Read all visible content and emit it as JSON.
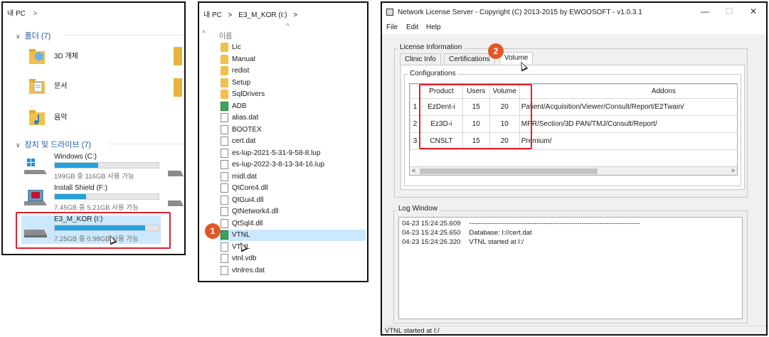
{
  "explorer_pc": {
    "breadcrumb": "내 PC",
    "breadcrumb_sep": ">",
    "folders_group": "폴더 (7)",
    "folders": [
      {
        "label": "3D 개체",
        "icon": "3d-objects-folder-icon"
      },
      {
        "label": "문서",
        "icon": "documents-folder-icon"
      },
      {
        "label": "음악",
        "icon": "music-folder-icon"
      }
    ],
    "drives_group": "장치 및 드라이브 (7)",
    "drives": [
      {
        "name": "Windows  (C:)",
        "size": "199GB 중 116GB 사용 가능",
        "used_fraction": 0.42,
        "icon": "windows-drive-icon",
        "selected": false
      },
      {
        "name": "Install Shield (F:)",
        "size": "7.45GB 중 5.21GB 사용 가능",
        "used_fraction": 0.3,
        "icon": "install-shield-drive-icon",
        "selected": false
      },
      {
        "name": "E3_M_KOR (I:)",
        "size": "7.25GB 중 0.98GB 사용 가능",
        "used_fraction": 0.87,
        "icon": "usb-drive-icon",
        "selected": true
      }
    ]
  },
  "explorer_drive": {
    "breadcrumb_root": "내 PC",
    "breadcrumb_sep": ">",
    "breadcrumb_drive": "E3_M_KOR (I:)",
    "breadcrumb_end": ">",
    "column_header": "이름",
    "sort_arrow": "^",
    "files": [
      {
        "name": "Lic",
        "type": "folder"
      },
      {
        "name": "Manual",
        "type": "folder"
      },
      {
        "name": "redist",
        "type": "folder"
      },
      {
        "name": "Setup",
        "type": "folder"
      },
      {
        "name": "SqlDrivers",
        "type": "folder"
      },
      {
        "name": "ADB",
        "type": "exe"
      },
      {
        "name": "alias.dat",
        "type": "file"
      },
      {
        "name": "BOOTEX",
        "type": "file"
      },
      {
        "name": "cert.dat",
        "type": "file"
      },
      {
        "name": "es-lup-2021-5-31-9-58-8.lup",
        "type": "file"
      },
      {
        "name": "es-lup-2022-3-8-13-34-16.lup",
        "type": "file"
      },
      {
        "name": "midl.dat",
        "type": "file"
      },
      {
        "name": "QtCore4.dll",
        "type": "dll"
      },
      {
        "name": "QtGui4.dll",
        "type": "dll"
      },
      {
        "name": "QtNetwork4.dll",
        "type": "dll"
      },
      {
        "name": "QtSql4.dll",
        "type": "dll"
      },
      {
        "name": "VTNL",
        "type": "exe"
      },
      {
        "name": "VTNL",
        "type": "file"
      },
      {
        "name": "vtnl.vdb",
        "type": "file"
      },
      {
        "name": "vtnlres.dat",
        "type": "file"
      }
    ],
    "selected_index": 16
  },
  "license_server": {
    "title": "Network License Server - Copyright (C) 2013-2015 by EWOOSOFT - v1.0.3.1",
    "window_buttons": {
      "minimize": "—",
      "maximize": "☐",
      "close": "✕"
    },
    "menu": [
      "File",
      "Edit",
      "Help"
    ],
    "license_info_title": "License Information",
    "tabs": [
      "Clinic Info",
      "Certifications",
      "Volume"
    ],
    "active_tab": "Volume",
    "configurations_title": "Configurations",
    "table": {
      "headers": [
        "",
        "Product",
        "Users",
        "Volume",
        "Addons"
      ],
      "rows": [
        {
          "idx": "1",
          "product": "EzDent-i",
          "users": "15",
          "volume": "20",
          "addons": "Patient/Acquisition/Viewer/Consult/Report/E2Twain/"
        },
        {
          "idx": "2",
          "product": "Ez3D-i",
          "users": "10",
          "volume": "10",
          "addons": "MPR/Section/3D PAN/TMJ/Consult/Report/"
        },
        {
          "idx": "3",
          "product": "CNSLT",
          "users": "15",
          "volume": "20",
          "addons": "Premium/"
        }
      ]
    },
    "scroll_left": "<",
    "scroll_right": ">",
    "log_title": "Log Window",
    "log": [
      {
        "time": "04-23 15:24:25.609",
        "msg": "----------------------------------------------------------------------------"
      },
      {
        "time": "04-23 15:24:25.650",
        "msg": "Database: I://cert.dat"
      },
      {
        "time": "04-23 15:24:26.320",
        "msg": "VTNL started at I:/"
      }
    ],
    "status": "VTNL started at I:/"
  },
  "annotations": {
    "step1": "1",
    "step2": "2",
    "highlight_color": "#e0222b",
    "badge_color": "#e0582a"
  }
}
